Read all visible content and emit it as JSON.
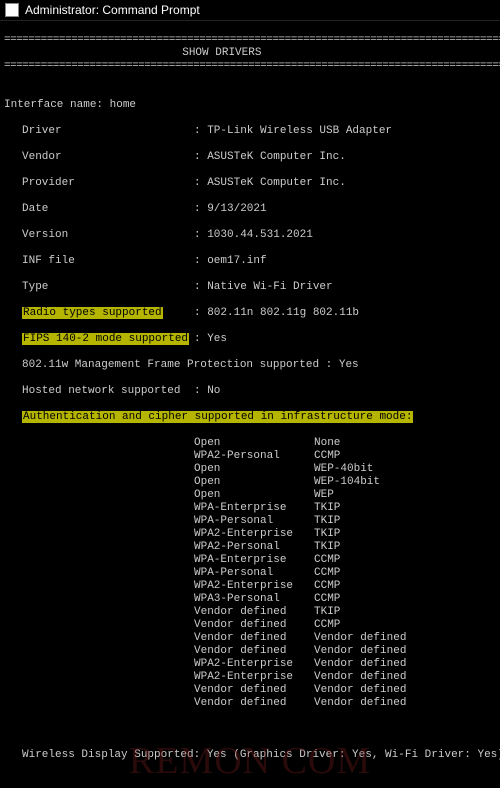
{
  "window": {
    "title": "Administrator: Command Prompt"
  },
  "header": {
    "sep_line": "=====================================================================================",
    "show_drivers": "SHOW DRIVERS",
    "interface_line": "Interface name: home"
  },
  "fields": {
    "driver": {
      "label": "Driver",
      "value": ": TP-Link Wireless USB Adapter"
    },
    "vendor": {
      "label": "Vendor",
      "value": ": ASUSTeK Computer Inc."
    },
    "provider": {
      "label": "Provider",
      "value": ": ASUSTeK Computer Inc."
    },
    "date": {
      "label": "Date",
      "value": ": 9/13/2021"
    },
    "version": {
      "label": "Version",
      "value": ": 1030.44.531.2021"
    },
    "inf": {
      "label": "INF file",
      "value": ": oem17.inf"
    },
    "type": {
      "label": "Type",
      "value": ": Native Wi-Fi Driver"
    },
    "radio": {
      "label": "Radio types supported",
      "value": ": 802.11n 802.11g 802.11b"
    },
    "fips": {
      "label": "FIPS 140-2 mode supported",
      "value": ": Yes"
    },
    "pmf": {
      "label": "802.11w Management Frame Protection supported : Yes"
    },
    "hosted": {
      "label": "Hosted network supported ",
      "value": ": No"
    },
    "authhdr": {
      "label": "Authentication and cipher supported in infrastructure mode:"
    }
  },
  "ciphers": [
    {
      "auth": "Open",
      "cipher": "None"
    },
    {
      "auth": "WPA2-Personal",
      "cipher": "CCMP"
    },
    {
      "auth": "Open",
      "cipher": "WEP-40bit"
    },
    {
      "auth": "Open",
      "cipher": "WEP-104bit"
    },
    {
      "auth": "Open",
      "cipher": "WEP"
    },
    {
      "auth": "WPA-Enterprise",
      "cipher": "TKIP"
    },
    {
      "auth": "WPA-Personal",
      "cipher": "TKIP"
    },
    {
      "auth": "WPA2-Enterprise",
      "cipher": "TKIP"
    },
    {
      "auth": "WPA2-Personal",
      "cipher": "TKIP"
    },
    {
      "auth": "WPA-Enterprise",
      "cipher": "CCMP"
    },
    {
      "auth": "WPA-Personal",
      "cipher": "CCMP"
    },
    {
      "auth": "WPA2-Enterprise",
      "cipher": "CCMP"
    },
    {
      "auth": "WPA3-Personal",
      "cipher": "CCMP"
    },
    {
      "auth": "Vendor defined",
      "cipher": "TKIP"
    },
    {
      "auth": "Vendor defined",
      "cipher": "CCMP"
    },
    {
      "auth": "Vendor defined",
      "cipher": "Vendor defined"
    },
    {
      "auth": "Vendor defined",
      "cipher": "Vendor defined"
    },
    {
      "auth": "WPA2-Enterprise",
      "cipher": "Vendor defined"
    },
    {
      "auth": "WPA2-Enterprise",
      "cipher": "Vendor defined"
    },
    {
      "auth": "Vendor defined",
      "cipher": "Vendor defined"
    },
    {
      "auth": "Vendor defined",
      "cipher": "Vendor defined"
    }
  ],
  "footer": {
    "wireless_display": "Wireless Display Supported: Yes (Graphics Driver: Yes, Wi-Fi Driver: Yes)"
  },
  "watermark": "REMON COM"
}
